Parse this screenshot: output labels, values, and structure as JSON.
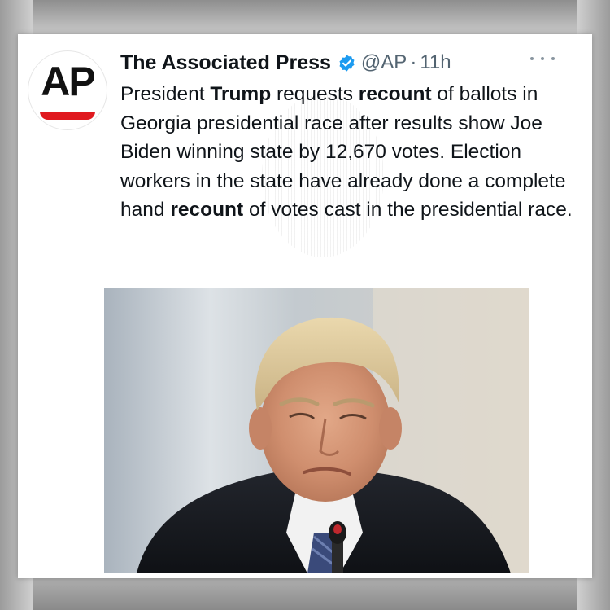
{
  "tweet": {
    "author_name": "The Associated Press",
    "handle": "@AP",
    "separator": "·",
    "time": "11h",
    "avatar_text": "AP",
    "verified_color": "#1d9bf0",
    "text_parts": [
      {
        "text": "President ",
        "bold": false
      },
      {
        "text": "Trump",
        "bold": true
      },
      {
        "text": " requests ",
        "bold": false
      },
      {
        "text": "recount",
        "bold": true
      },
      {
        "text": " of ballots in Georgia presidential race after results show Joe Biden winning state by 12,670 votes. Election workers in the state have already done a complete hand ",
        "bold": false
      },
      {
        "text": "recount",
        "bold": true
      },
      {
        "text": " of votes cast in the presidential race.",
        "bold": false
      }
    ]
  },
  "icons": {
    "verified": "verified-badge-icon",
    "more": "more-options-icon"
  },
  "colors": {
    "brand_red": "#e0191f",
    "text": "#0f1419",
    "muted": "#536471"
  }
}
